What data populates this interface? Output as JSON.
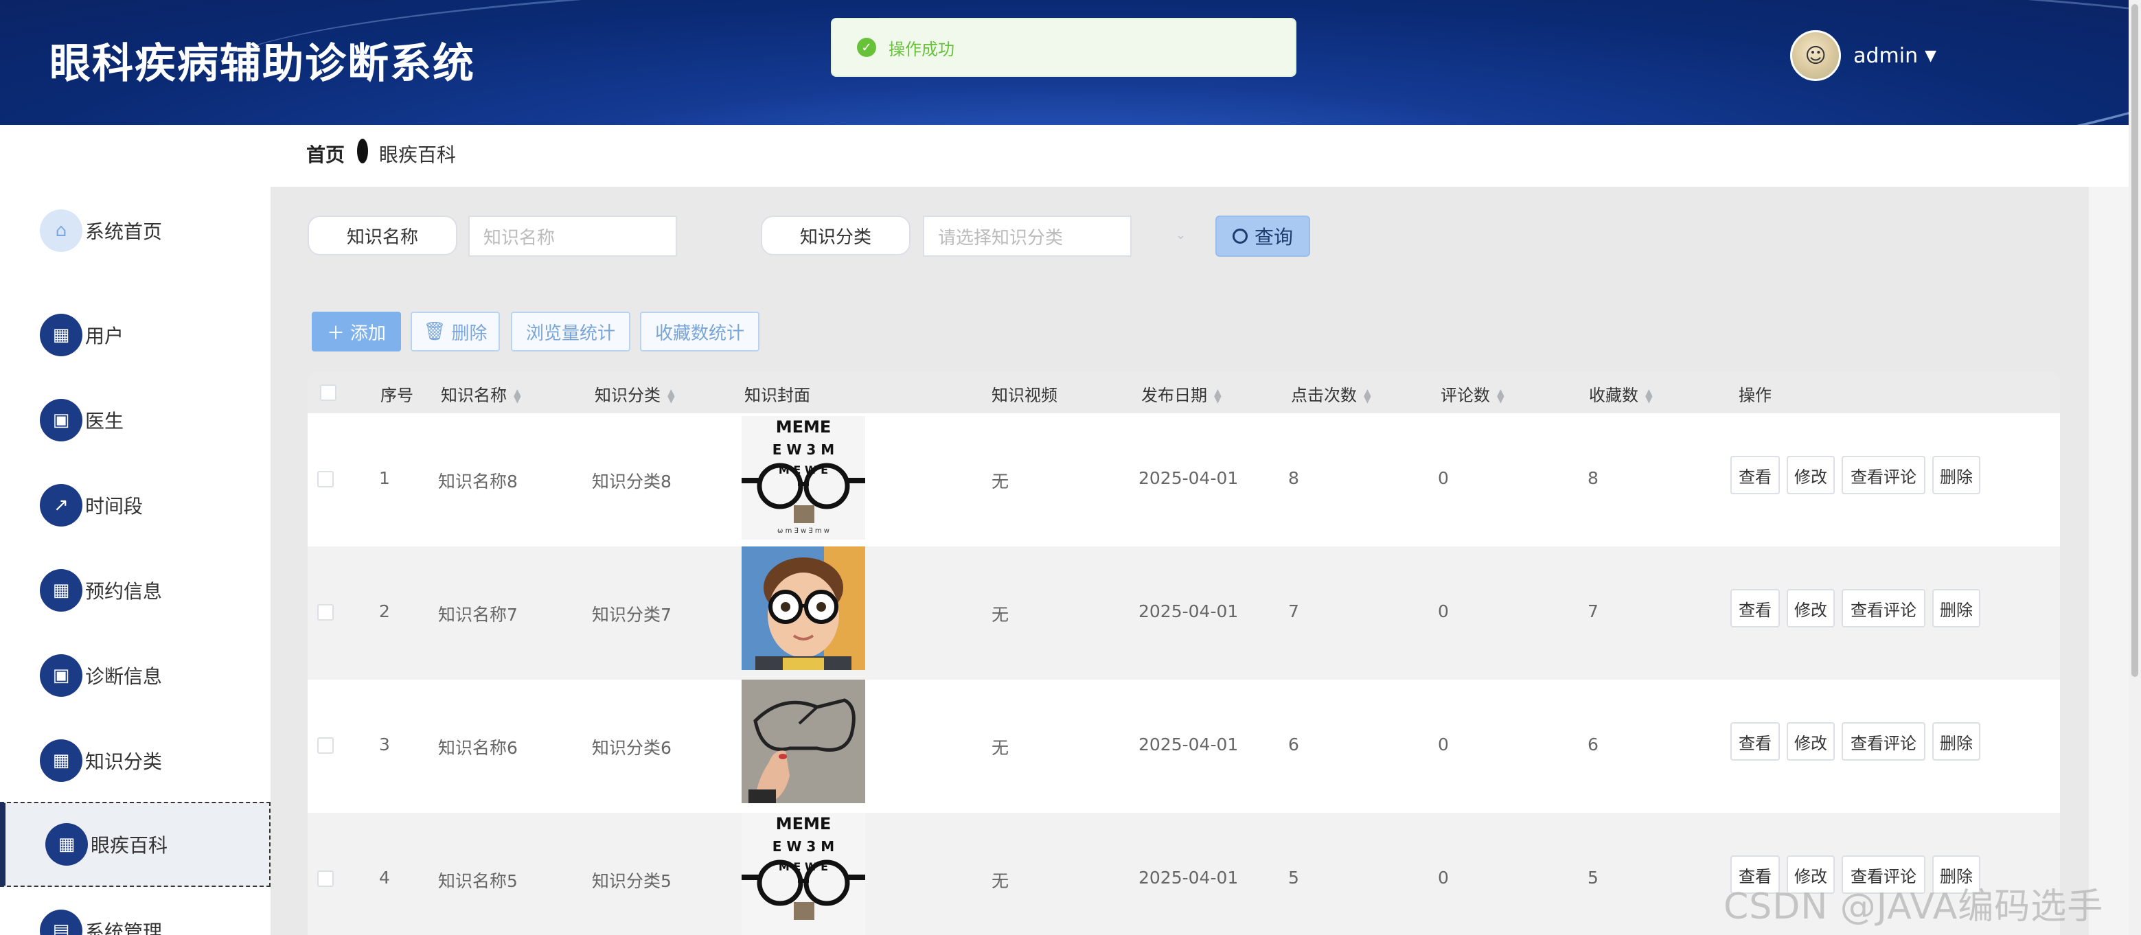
{
  "header": {
    "title": "眼科疾病辅助诊断系统",
    "user": "admin"
  },
  "toast": {
    "message": "操作成功"
  },
  "breadcrumb": {
    "home": "首页",
    "current": "眼疾百科"
  },
  "sidebar": {
    "items": [
      {
        "label": "系统首页",
        "icon": "home-icon"
      },
      {
        "label": "用户",
        "icon": "grid-icon"
      },
      {
        "label": "医生",
        "icon": "briefcase-icon"
      },
      {
        "label": "时间段",
        "icon": "chart-icon"
      },
      {
        "label": "预约信息",
        "icon": "grid-icon"
      },
      {
        "label": "诊断信息",
        "icon": "briefcase-icon"
      },
      {
        "label": "知识分类",
        "icon": "grid-icon"
      },
      {
        "label": "眼疾百科",
        "icon": "grid-icon"
      },
      {
        "label": "系统管理",
        "icon": "clipboard-icon"
      }
    ]
  },
  "search": {
    "name_label": "知识名称",
    "name_placeholder": "知识名称",
    "category_label": "知识分类",
    "category_placeholder": "请选择知识分类",
    "query_label": "查询"
  },
  "toolbar": {
    "add_label": "添加",
    "delete_label": "删除",
    "views_stat_label": "浏览量统计",
    "fav_stat_label": "收藏数统计"
  },
  "table": {
    "headers": {
      "index": "序号",
      "name": "知识名称",
      "category": "知识分类",
      "cover": "知识封面",
      "video": "知识视频",
      "date": "发布日期",
      "clicks": "点击次数",
      "comments": "评论数",
      "favorites": "收藏数",
      "actions": "操作"
    },
    "rows": [
      {
        "index": "1",
        "name": "知识名称8",
        "category": "知识分类8",
        "video": "无",
        "date": "2025-04-01",
        "clicks": "8",
        "comments": "0",
        "favorites": "8",
        "cover": "eye-chart"
      },
      {
        "index": "2",
        "name": "知识名称7",
        "category": "知识分类7",
        "video": "无",
        "date": "2025-04-01",
        "clicks": "7",
        "comments": "0",
        "favorites": "7",
        "cover": "child-glasses"
      },
      {
        "index": "3",
        "name": "知识名称6",
        "category": "知识分类6",
        "video": "无",
        "date": "2025-04-01",
        "clicks": "6",
        "comments": "0",
        "favorites": "6",
        "cover": "hand-glasses"
      },
      {
        "index": "4",
        "name": "知识名称5",
        "category": "知识分类5",
        "video": "无",
        "date": "2025-04-01",
        "clicks": "5",
        "comments": "0",
        "favorites": "5",
        "cover": "eye-chart"
      }
    ],
    "actions": {
      "view": "查看",
      "edit": "修改",
      "view_comments": "查看评论",
      "delete": "删除"
    }
  },
  "watermark": "CSDN @JAVA编码选手",
  "colors": {
    "header": "#0f2f7c",
    "menu_icon": "#1b3b86",
    "toast": "#67c23a",
    "primary_light": "#7fb2ec"
  }
}
